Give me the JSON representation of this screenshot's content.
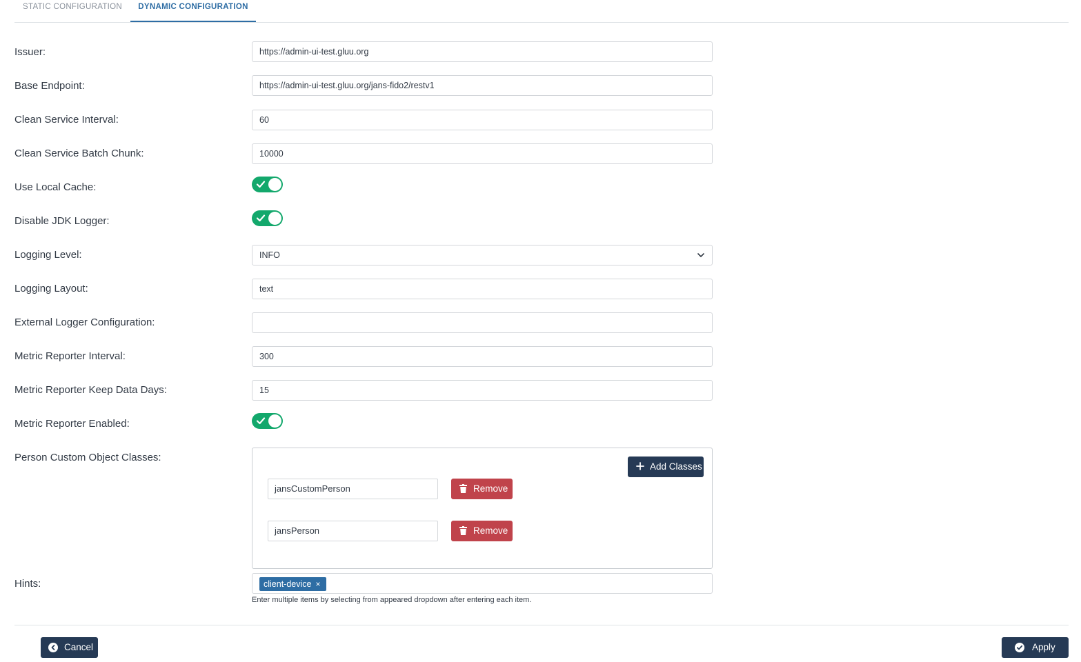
{
  "tabs": [
    {
      "label": "STATIC CONFIGURATION",
      "active": false
    },
    {
      "label": "DYNAMIC CONFIGURATION",
      "active": true
    }
  ],
  "form": {
    "issuer": {
      "label": "Issuer:",
      "value": "https://admin-ui-test.gluu.org"
    },
    "base_endpoint": {
      "label": "Base Endpoint:",
      "value": "https://admin-ui-test.gluu.org/jans-fido2/restv1"
    },
    "clean_service_interval": {
      "label": "Clean Service Interval:",
      "value": "60"
    },
    "clean_service_batch_chunk": {
      "label": "Clean Service Batch Chunk:",
      "value": "10000"
    },
    "use_local_cache": {
      "label": "Use Local Cache:",
      "enabled": true
    },
    "disable_jdk_logger": {
      "label": "Disable JDK Logger:",
      "enabled": true
    },
    "logging_level": {
      "label": "Logging Level:",
      "value": "INFO"
    },
    "logging_layout": {
      "label": "Logging Layout:",
      "value": "text"
    },
    "external_logger_configuration": {
      "label": "External Logger Configuration:",
      "value": ""
    },
    "metric_reporter_interval": {
      "label": "Metric Reporter Interval:",
      "value": "300"
    },
    "metric_reporter_keep_data_days": {
      "label": "Metric Reporter Keep Data Days:",
      "value": "15"
    },
    "metric_reporter_enabled": {
      "label": "Metric Reporter Enabled:",
      "enabled": true
    },
    "person_custom_object_classes": {
      "label": "Person Custom Object Classes:",
      "add_label": "Add Classes",
      "remove_label": "Remove",
      "items": [
        "jansCustomPerson",
        "jansPerson"
      ]
    },
    "hints": {
      "label": "Hints:",
      "chips": [
        "client-device"
      ],
      "help_text": "Enter multiple items by selecting from appeared dropdown after entering each item."
    }
  },
  "footer": {
    "cancel_label": "Cancel",
    "apply_label": "Apply"
  },
  "colors": {
    "primary": "#263a55",
    "accent": "#2e6da4",
    "toggle_on": "#13a86c",
    "danger": "#c0434b"
  }
}
